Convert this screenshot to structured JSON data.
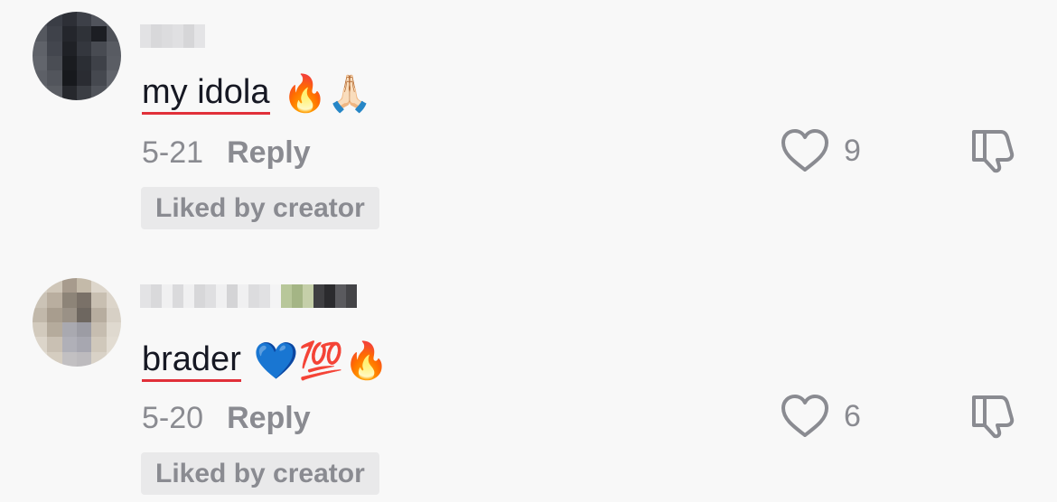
{
  "comments": [
    {
      "text": "my idola",
      "emoji": "🔥🙏🏻",
      "date": "5-21",
      "reply_label": "Reply",
      "like_count": "9",
      "badge": "Liked by creator"
    },
    {
      "text": "brader",
      "emoji": "💙💯🔥",
      "date": "5-20",
      "reply_label": "Reply",
      "like_count": "6",
      "badge": "Liked by creator"
    }
  ],
  "colors": {
    "text": "#161823",
    "muted": "#8a8b91",
    "underline": "#e1303a",
    "badge_bg": "#e9e9ea",
    "background": "#f8f8f8"
  }
}
